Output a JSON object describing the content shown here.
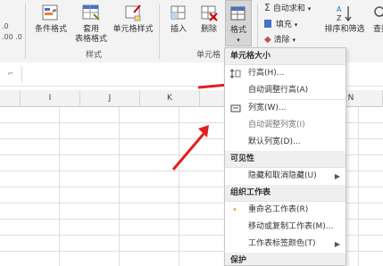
{
  "ribbon": {
    "left_partial": ".0\n.00 .0",
    "conditional_format": "条件格式",
    "table_format_1": "套用",
    "table_format_2": "表格格式",
    "cell_style": "单元格样式",
    "insert": "插入",
    "delete": "删除",
    "format": "格式",
    "styles_group": "样式",
    "cells_group": "单元格",
    "autosum": "自动求和",
    "fill": "填充",
    "clear": "清除",
    "sort_filter": "排序和筛选",
    "find_select": "查找"
  },
  "columns": [
    "I",
    "J",
    "K",
    "N"
  ],
  "menu": {
    "section_cell_size": "单元格大小",
    "row_height": "行高(H)...",
    "autofit_row": "自动调整行高(A)",
    "col_width": "列宽(W)...",
    "autofit_col": "自动调整列宽(I)",
    "default_width": "默认列宽(D)...",
    "section_visibility": "可见性",
    "hide_unhide": "隐藏和取消隐藏(U)",
    "section_organize": "组织工作表",
    "rename": "重命名工作表(R)",
    "move_copy": "移动或复制工作表(M)...",
    "tab_color": "工作表标签颜色(T)",
    "section_protect": "保护"
  },
  "colors": {
    "red_arrow": "#e02020",
    "accent": "#217346"
  }
}
